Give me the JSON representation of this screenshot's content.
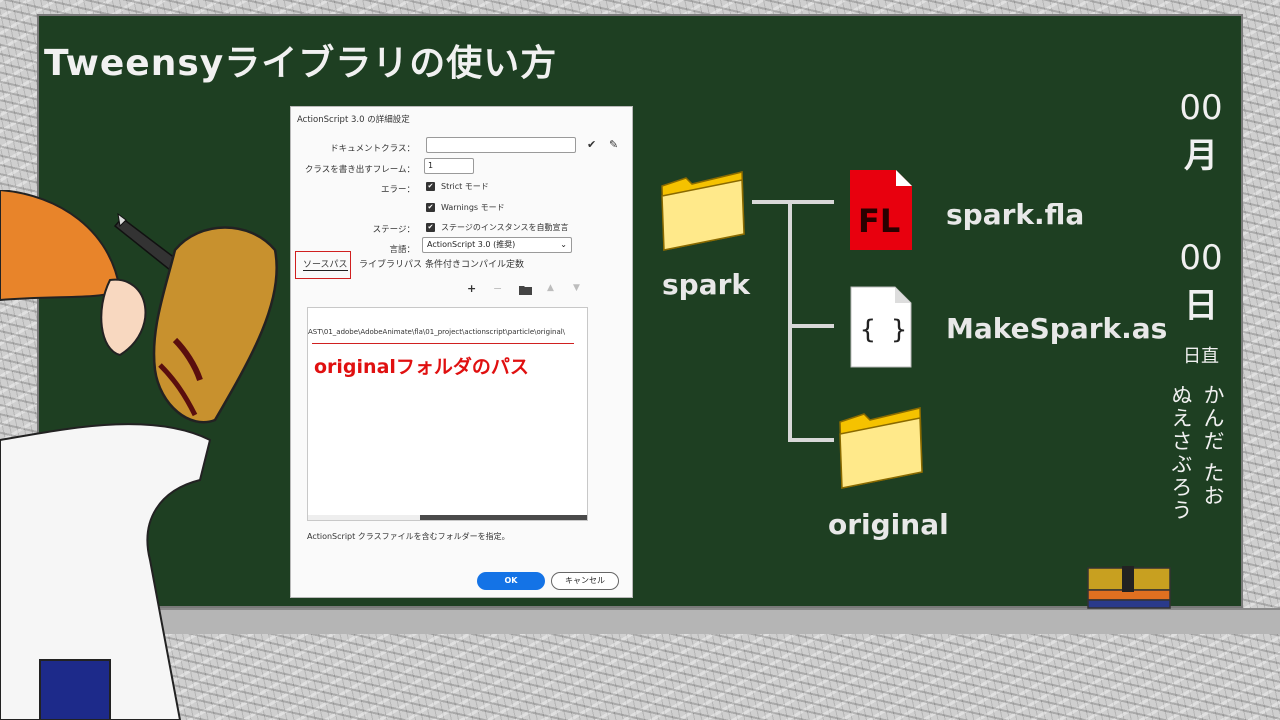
{
  "slide": {
    "title": "Tweensyライブラリの使い方"
  },
  "dialog": {
    "title": "ActionScript 3.0 の詳細設定",
    "document_class_label": "ドキュメントクラス：",
    "document_class_value": "",
    "export_frame_label": "クラスを書き出すフレーム：",
    "export_frame_value": "1",
    "errors_label": "エラー：",
    "strict_mode_label": "Strict モード",
    "warnings_mode_label": "Warnings モード",
    "stage_label": "ステージ：",
    "stage_auto_declare_label": "ステージのインスタンスを自動宣言",
    "dialect_label": "言語：",
    "dialect_value": "ActionScript 3.0 (推奨)",
    "tabs": [
      {
        "label": "ソースパス"
      },
      {
        "label": "ライブラリパス"
      },
      {
        "label": "条件付きコンパイル定数"
      }
    ],
    "tools": {
      "add": "+",
      "remove": "−",
      "browse_icon": "folder-icon",
      "up": "▲",
      "down": "▼"
    },
    "source_path": "AST\\01_adobe\\AdobeAnimate\\fla\\01_project\\actionscript\\particle\\original\\",
    "annotation": "originalフォルダのパス",
    "description": "ActionScript クラスファイルを含むフォルダーを指定。",
    "ok_label": "OK",
    "cancel_label": "キャンセル"
  },
  "diagram": {
    "root_folder": "spark",
    "files": [
      {
        "name": "spark.fla",
        "icon": "fl-file-icon",
        "badge": "FL",
        "color": "#e8000e"
      },
      {
        "name": "MakeSpark.as",
        "icon": "as-file-icon",
        "badge": "{ }"
      }
    ],
    "sub_folder": "original"
  },
  "side": {
    "month_num": "00",
    "month_unit": "月",
    "day_num": "00",
    "day_unit": "日",
    "duty_label": "日直",
    "names": [
      "かんだ たお",
      "ぬえさぶろう"
    ]
  }
}
